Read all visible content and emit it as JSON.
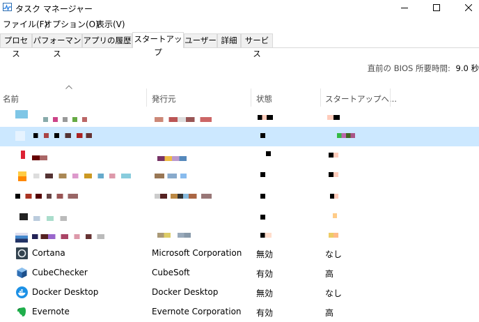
{
  "window": {
    "title": "タスク マネージャー"
  },
  "menu": [
    "ファイル(F)",
    "オプション(O)",
    "表示(V)"
  ],
  "tabs": [
    "プロセス",
    "パフォーマンス",
    "アプリの履歴",
    "スタートアップ",
    "ユーザー",
    "詳細",
    "サービス"
  ],
  "active_tab": "スタートアップ",
  "bios": {
    "label": "直前の BIOS 所要時間:",
    "value": "9.0 秒"
  },
  "columns": [
    "名前",
    "発行元",
    "状態",
    "スタートアップへ..."
  ],
  "startup_items": [
    {
      "name": "Cortana",
      "publisher": "Microsoft Corporation",
      "status": "無効",
      "impact": "なし",
      "icon": "cortana-icon"
    },
    {
      "name": "CubeChecker",
      "publisher": "CubeSoft",
      "status": "有効",
      "impact": "高",
      "icon": "cubechecker-icon"
    },
    {
      "name": "Docker Desktop",
      "publisher": "Docker Desktop",
      "status": "無効",
      "impact": "なし",
      "icon": "docker-icon"
    },
    {
      "name": "Evernote",
      "publisher": "Evernote Corporation",
      "status": "有効",
      "impact": "高",
      "icon": "evernote-icon"
    }
  ],
  "colors": {
    "selected_row": "#cce8ff",
    "tab_border": "#d9d9d9"
  }
}
